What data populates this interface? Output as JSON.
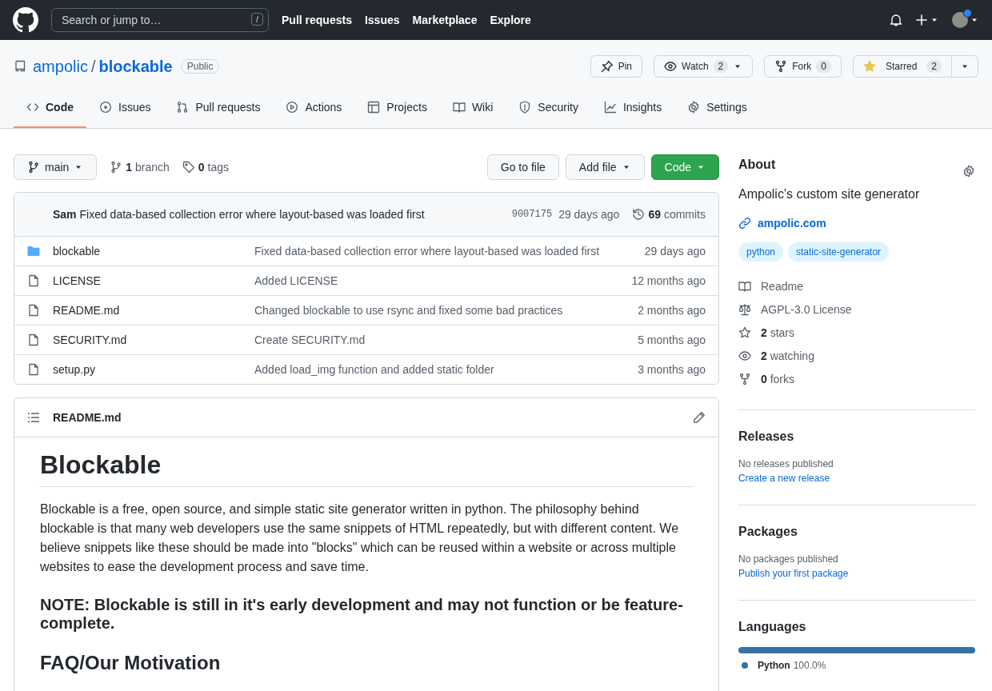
{
  "header": {
    "search_placeholder": "Search or jump to…",
    "search_key": "/",
    "nav": [
      "Pull requests",
      "Issues",
      "Marketplace",
      "Explore"
    ],
    "has_notification": true
  },
  "repo": {
    "owner": "ampolic",
    "separator": "/",
    "name": "blockable",
    "visibility": "Public"
  },
  "repo_actions": {
    "pin": "Pin",
    "watch": "Watch",
    "watch_count": "2",
    "fork": "Fork",
    "fork_count": "0",
    "star": "Starred",
    "star_count": "2",
    "starred": true
  },
  "tabs": [
    {
      "label": "Code",
      "selected": true
    },
    {
      "label": "Issues",
      "selected": false
    },
    {
      "label": "Pull requests",
      "selected": false
    },
    {
      "label": "Actions",
      "selected": false
    },
    {
      "label": "Projects",
      "selected": false
    },
    {
      "label": "Wiki",
      "selected": false
    },
    {
      "label": "Security",
      "selected": false
    },
    {
      "label": "Insights",
      "selected": false
    },
    {
      "label": "Settings",
      "selected": false
    }
  ],
  "branch_bar": {
    "branch": "main",
    "branches": "**1** branch",
    "tags": "**0** tags",
    "go_to_file": "Go to file",
    "add_file": "Add file",
    "code": "Code"
  },
  "commit": {
    "message": "**Sam** Fixed data-based collection error where layout-based was loaded first",
    "sha": "9007175",
    "time": "29 days ago",
    "commits": "**69** commits"
  },
  "files": [
    {
      "kind": "folder",
      "name": "blockable",
      "message": "Fixed data-based collection error where layout-based was loaded first",
      "time": "29 days ago"
    },
    {
      "kind": "file",
      "name": "LICENSE",
      "message": "Added LICENSE",
      "time": "12 months ago"
    },
    {
      "kind": "file",
      "name": "README.md",
      "message": "Changed blockable to use rsync and fixed some bad practices",
      "time": "2 months ago"
    },
    {
      "kind": "file",
      "name": "SECURITY.md",
      "message": "Create SECURITY.md",
      "time": "5 months ago"
    },
    {
      "kind": "file",
      "name": "setup.py",
      "message": "Added load_img function and added static folder",
      "time": "3 months ago"
    }
  ],
  "readme": {
    "filename": "README.md",
    "title": "Blockable",
    "paragraph": "Blockable is a free, open source, and simple static site generator written in python. The philosophy behind blockable is that many web developers use the same snippets of HTML repeatedly, but with different content. We believe snippets like these should be made into \"blocks\" which can be reused within a website or across multiple websites to ease the development process and save time.",
    "note": "NOTE: Blockable is still in it's early development and may not function or be feature-complete.",
    "subheading": "FAQ/Our Motivation"
  },
  "about": {
    "title": "About",
    "description": "Ampolic's custom site generator",
    "website": "ampolic.com",
    "topics": [
      "python",
      "static-site-generator"
    ],
    "stats": [
      {
        "kind": "readme",
        "text": "Readme"
      },
      {
        "kind": "license",
        "text": "AGPL-3.0 License"
      },
      {
        "kind": "stars",
        "text": "**2** stars"
      },
      {
        "kind": "watching",
        "text": "**2** watching"
      },
      {
        "kind": "forks",
        "text": "**0** forks"
      }
    ]
  },
  "releases": {
    "title": "Releases",
    "note": "No releases published",
    "link": "Create a new release"
  },
  "packages": {
    "title": "Packages",
    "note": "No packages published",
    "link": "Publish your first package"
  },
  "languages": {
    "title": "Languages",
    "items": [
      {
        "name": "Python",
        "percent": "100.0%",
        "level": 1.0,
        "color": "#3572a5"
      }
    ]
  }
}
